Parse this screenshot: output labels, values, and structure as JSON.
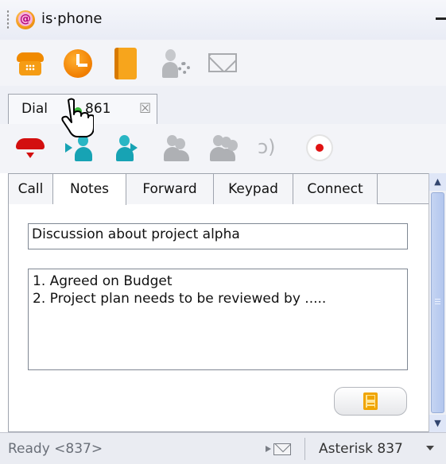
{
  "app": {
    "title": "is·phone"
  },
  "call_tab": {
    "label": "Dial",
    "number": "861",
    "close_glyph": "☒"
  },
  "icons": {
    "toolbar": [
      "phone-icon",
      "clock-icon",
      "address-book-icon",
      "user-settings-icon",
      "message-envelope-icon"
    ],
    "call_controls": [
      "hangup-icon",
      "transfer-icon",
      "consult-icon",
      "conference-icon",
      "group-icon",
      "voice-icon",
      "record-icon"
    ]
  },
  "notes_tabs": [
    "Call",
    "Notes",
    "Forward",
    "Keypad",
    "Connect"
  ],
  "active_tab": "Notes",
  "notes": {
    "subject": "Discussion about project alpha",
    "line1": "1. Agreed on Budget",
    "line2": "2. Project plan needs to be reviewed by ....."
  },
  "status": {
    "text": "Ready <837>",
    "account": "Asterisk 837"
  },
  "colors": {
    "accent_orange": "#f39a1a",
    "teal": "#17a3b4",
    "hangup_red": "#d30f0f",
    "record_red": "#e01212"
  }
}
